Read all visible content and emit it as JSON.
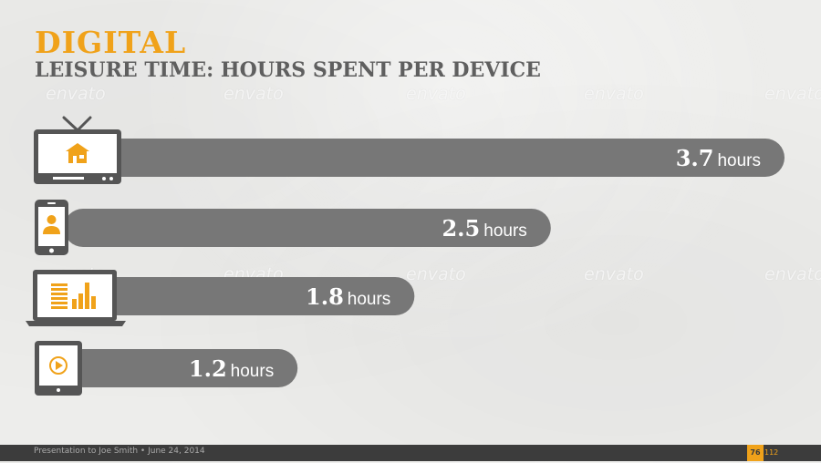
{
  "slide": {
    "title": "DIGITAL",
    "subtitle": "LEISURE TIME: HOURS SPENT PER DEVICE",
    "watermark": "envato"
  },
  "chart_data": {
    "type": "bar",
    "orientation": "horizontal",
    "categories": [
      "tv-icon",
      "smartphone-icon",
      "laptop-icon",
      "tablet-icon"
    ],
    "values": [
      3.7,
      2.5,
      1.8,
      1.2
    ],
    "value_labels": [
      "3.7",
      "2.5",
      "1.8",
      "1.2"
    ],
    "unit": "hours",
    "xlim": [
      0,
      3.7
    ],
    "title": "LEISURE TIME: HOURS SPENT PER DEVICE",
    "grid": false,
    "bar_color": "#777777",
    "icon_color": "#555555",
    "accent_color": "#f0a21a"
  },
  "footer": {
    "text": "Presentation to Joe Smith • June 24, 2014",
    "page": "76",
    "total": "112"
  },
  "colors": {
    "accent": "#f0a21a",
    "footer_bg": "#3c3c3c",
    "background": "#ededeb"
  }
}
